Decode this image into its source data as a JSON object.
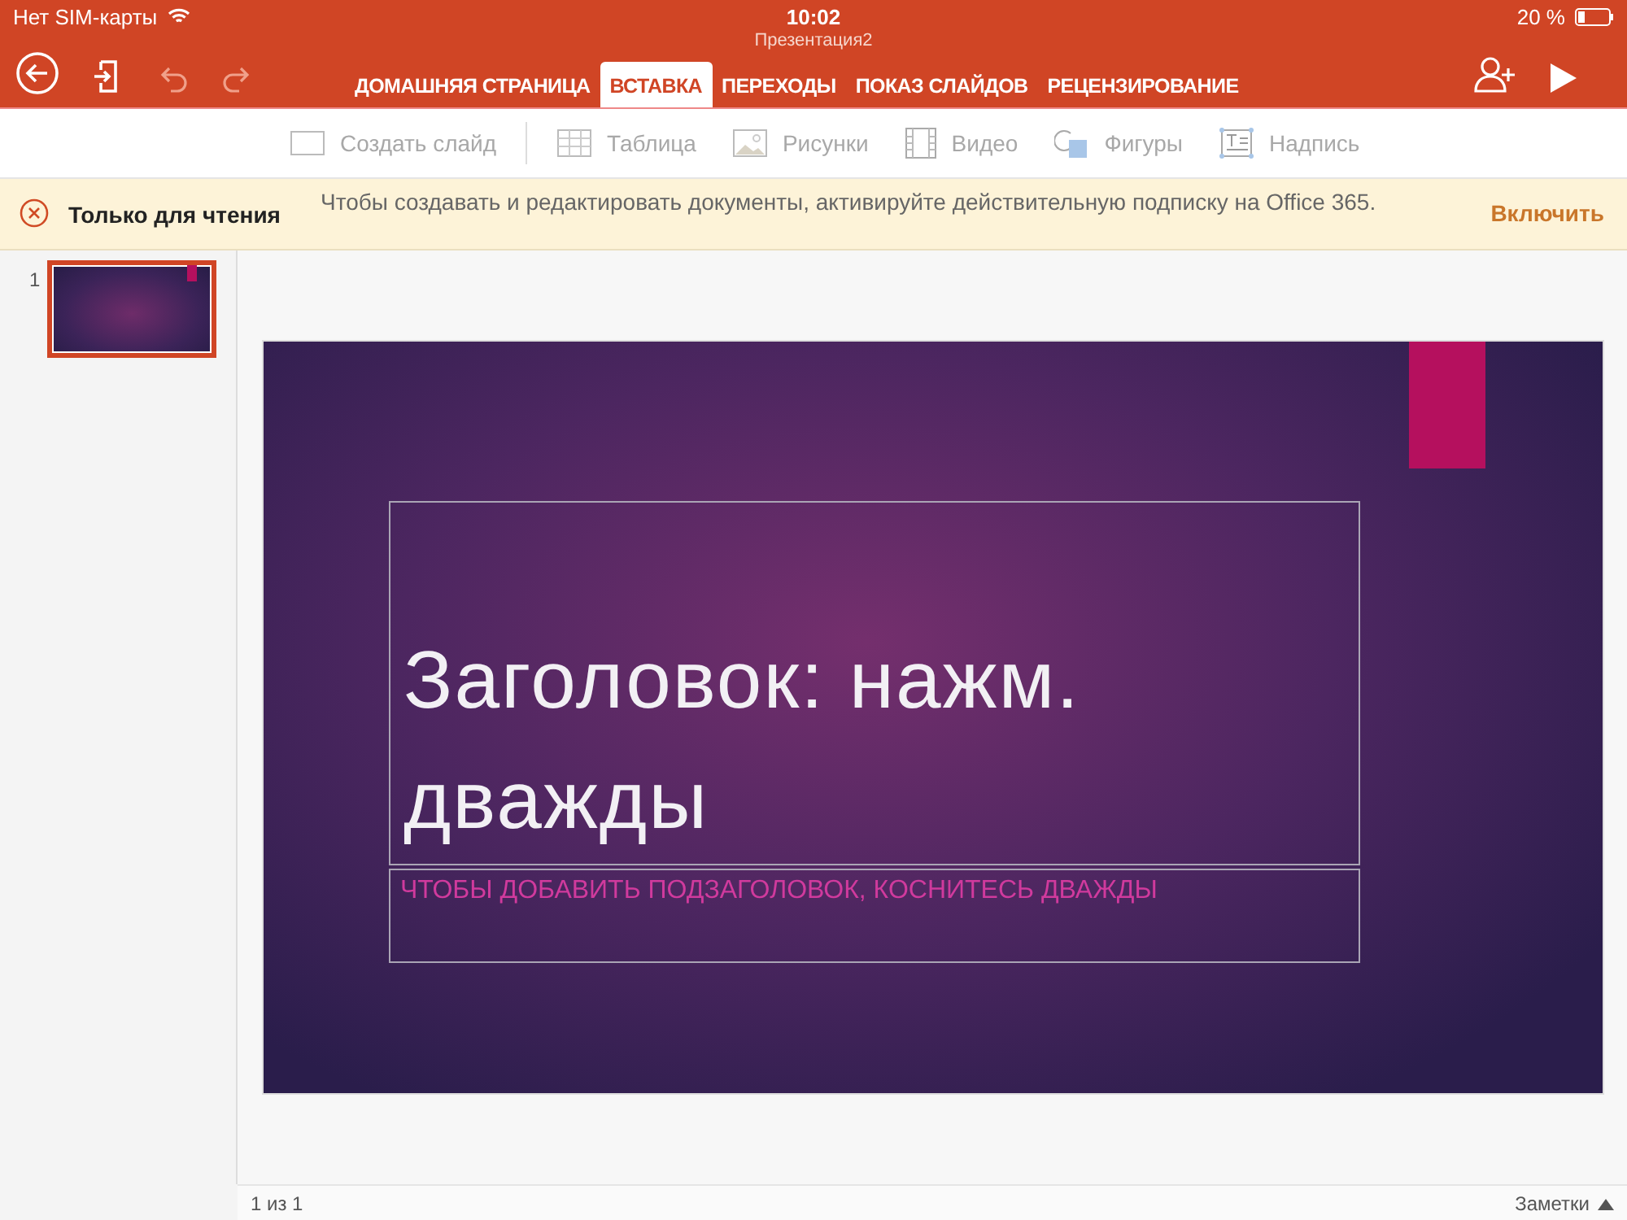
{
  "status_bar": {
    "carrier": "Нет SIM-карты",
    "time": "10:02",
    "battery": "20 %"
  },
  "document_title": "Презентация2",
  "tabs": [
    {
      "label": "ДОМАШНЯЯ СТРАНИЦА",
      "selected": false
    },
    {
      "label": "ВСТАВКА",
      "selected": true
    },
    {
      "label": "ПЕРЕХОДЫ",
      "selected": false
    },
    {
      "label": "ПОКАЗ СЛАЙДОВ",
      "selected": false
    },
    {
      "label": "РЕЦЕНЗИРОВАНИЕ",
      "selected": false
    }
  ],
  "ribbon": [
    {
      "kind": "new-slide",
      "label": "Создать слайд",
      "disabled": true
    },
    {
      "kind": "table",
      "label": "Таблица",
      "disabled": true
    },
    {
      "kind": "pictures",
      "label": "Рисунки",
      "disabled": true
    },
    {
      "kind": "video",
      "label": "Видео",
      "disabled": true
    },
    {
      "kind": "shapes",
      "label": "Фигуры",
      "disabled": true
    },
    {
      "kind": "textbox",
      "label": "Надпись",
      "disabled": true
    }
  ],
  "notice": {
    "title": "Только для чтения",
    "message": "Чтобы создавать и редактировать документы, активируйте действительную подписку на Office 365.",
    "action": "Включить"
  },
  "thumbnails": [
    {
      "number": "1",
      "selected": true
    }
  ],
  "slide": {
    "title": "Заголовок: нажм. дважды",
    "subtitle": "ЧТОБЫ ДОБАВИТЬ ПОДЗАГОЛОВОК, КОСНИТЕСЬ ДВАЖДЫ"
  },
  "footer": {
    "page": "1 из 1",
    "notes": "Заметки"
  }
}
